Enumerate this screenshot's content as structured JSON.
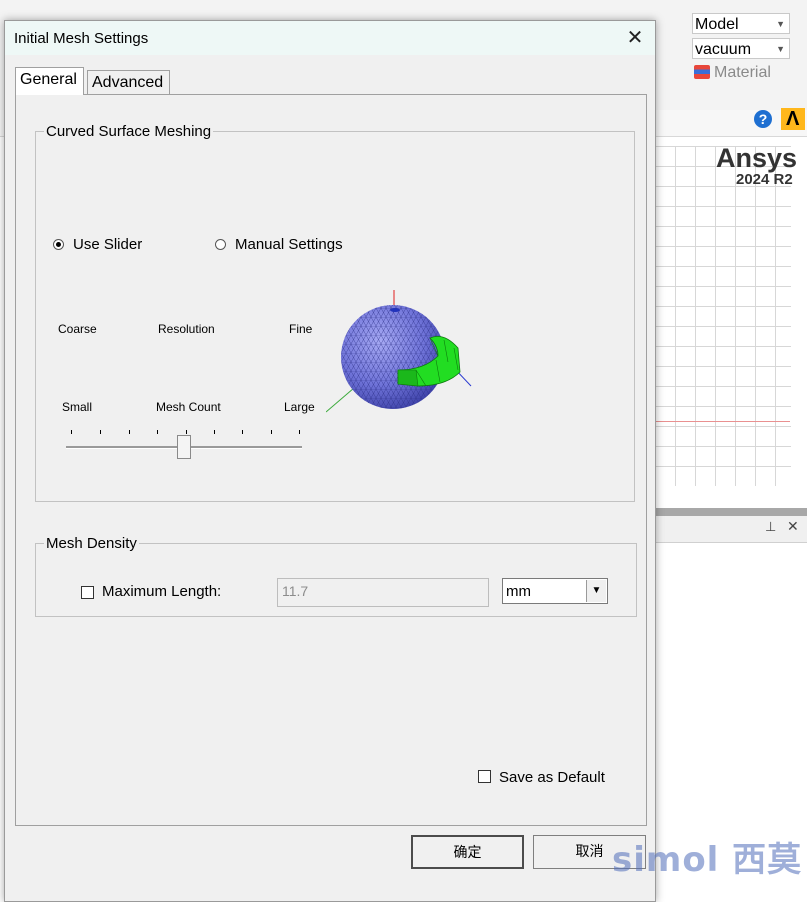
{
  "background": {
    "combo_model": "Model",
    "combo_material": "vacuum",
    "material_label": "Material",
    "help_icon": "?",
    "ansys_logo_letter": "Λ",
    "brand_name": "Ansys",
    "brand_version": "2024 R2",
    "pin_icon": "⊥",
    "close_icon": "✕"
  },
  "dialog": {
    "title": "Initial Mesh Settings",
    "close_icon": "✕",
    "tabs": [
      {
        "label": "General",
        "active": true
      },
      {
        "label": "Advanced",
        "active": false
      }
    ],
    "curved": {
      "legend": "Curved Surface Meshing",
      "use_slider_label": "Use Slider",
      "manual_settings_label": "Manual Settings",
      "slider_top_labels": [
        "Coarse",
        "Resolution",
        "Fine"
      ],
      "slider_bottom_labels": [
        "Small",
        "Mesh Count",
        "Large"
      ],
      "slider_level": 0.5
    },
    "density": {
      "legend": "Mesh Density",
      "max_length_label": "Maximum Length:",
      "max_length_value": "11.7",
      "unit": "mm",
      "dropdown_icon": "▼"
    },
    "save_default_label": "Save as Default",
    "ok_label": "确定",
    "cancel_label": "取消"
  },
  "watermark": "simol 西莫",
  "colors": {
    "sphere": "#6f73d8",
    "mesh_band": "#22dd22",
    "titlebar": "#eef8f6",
    "help": "#1e6fd1",
    "ansys_logo": "#ffb71b"
  }
}
